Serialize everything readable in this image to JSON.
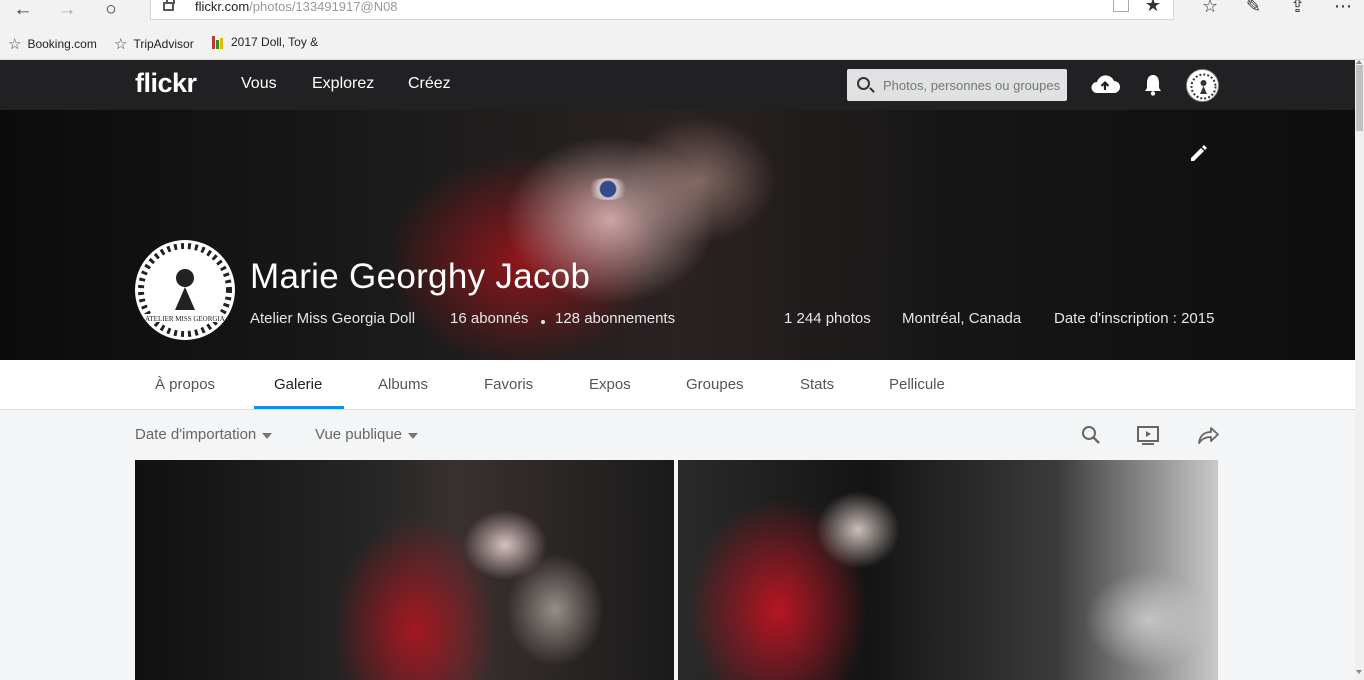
{
  "browser": {
    "url_domain": "flickr.com",
    "url_path": "/photos/133491917@N08",
    "back_icon": "←",
    "forward_icon": "→",
    "refresh_icon": "○",
    "star_icon": "☆",
    "more_icon": "⋯"
  },
  "favorites": [
    {
      "label": "Booking.com",
      "icon": "☆"
    },
    {
      "label": "TripAdvisor",
      "icon": "☆"
    },
    {
      "label": "2017 Doll, Toy &",
      "icon": "bar-chart"
    }
  ],
  "header": {
    "logo": "flickr",
    "nav": [
      "Vous",
      "Explorez",
      "Créez"
    ],
    "search_placeholder": "Photos, personnes ou groupes"
  },
  "profile": {
    "name": "Marie Georghy Jacob",
    "subtitle": "Atelier Miss Georgia Doll",
    "followers": "16 abonnés",
    "following": "128 abonnements",
    "photos": "1 244 photos",
    "location": "Montréal, Canada",
    "joined": "Date d'inscription : 2015",
    "avatar_text": "ATELIER MISS GEORGIA"
  },
  "tabs": [
    "À propos",
    "Galerie",
    "Albums",
    "Favoris",
    "Expos",
    "Groupes",
    "Stats",
    "Pellicule"
  ],
  "active_tab": "Galerie",
  "filters": {
    "sort": "Date d'importation",
    "view": "Vue publique"
  },
  "colors": {
    "topbar": "#212124",
    "accent_tab": "#128fdc",
    "page_bg": "#f3f5f6"
  }
}
